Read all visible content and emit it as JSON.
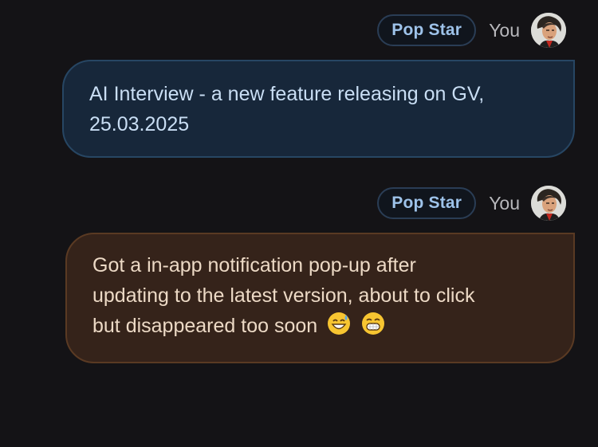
{
  "messages": [
    {
      "badge": "Pop Star",
      "sender": "You",
      "lines": [
        "AI Interview - a new feature releasing on GV,",
        "25.03.2025"
      ],
      "emojis": [],
      "colors": {
        "bubble": "#17273a",
        "border": "#274663",
        "text": "#c9def4"
      }
    },
    {
      "badge": "Pop Star",
      "sender": "You",
      "lines": [
        "Got a in-app notification pop-up after",
        "updating to the latest version, about to click",
        "but disappeared too soon"
      ],
      "emojis": [
        "grinning-face-with-sweat-icon",
        "beaming-face-icon"
      ],
      "colors": {
        "bubble": "#35231a",
        "border": "#5a3a23",
        "text": "#ecd9c5"
      }
    }
  ],
  "accent": {
    "badge_text": "#9ec3ea",
    "badge_border": "#2a3d55"
  }
}
